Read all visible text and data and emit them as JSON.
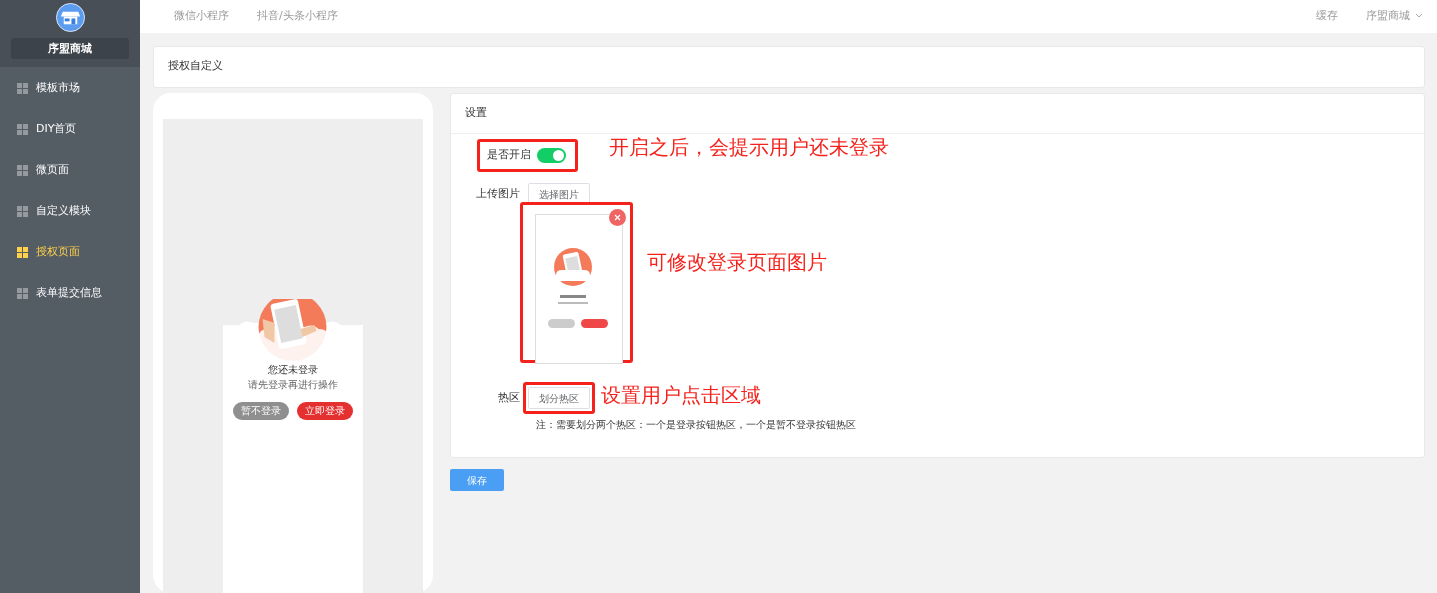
{
  "sidebar": {
    "brand": "序盟商城",
    "items": [
      {
        "label": "模板市场",
        "selected": false
      },
      {
        "label": "DIY首页",
        "selected": false
      },
      {
        "label": "微页面",
        "selected": false
      },
      {
        "label": "自定义模块",
        "selected": false
      },
      {
        "label": "授权页面",
        "selected": true
      },
      {
        "label": "表单提交信息",
        "selected": false
      }
    ]
  },
  "top_tabs": [
    "微信小程序",
    "抖音/头条小程序"
  ],
  "top_right": {
    "cache": "缓存",
    "account": "序盟商城"
  },
  "page_title": "授权自定义",
  "preview": {
    "title": "您还未登录",
    "subtitle": "请先登录再进行操作",
    "buttons": [
      {
        "label": "暂不登录",
        "kind": "secondary"
      },
      {
        "label": "立即登录",
        "kind": "primary"
      }
    ]
  },
  "settings": {
    "title": "设置",
    "enable": {
      "label": "是否开启",
      "on": true
    },
    "upload": {
      "label": "上传图片",
      "button": "选择图片"
    },
    "hotzone": {
      "label": "热区",
      "button": "划分热区",
      "note": "注：需要划分两个热区：一个是登录按钮热区，一个是暂不登录按钮热区"
    },
    "save": "保存"
  },
  "annotations": [
    "开启之后，会提示用户还未登录",
    "可修改登录页面图片",
    "设置用户点击区域"
  ]
}
